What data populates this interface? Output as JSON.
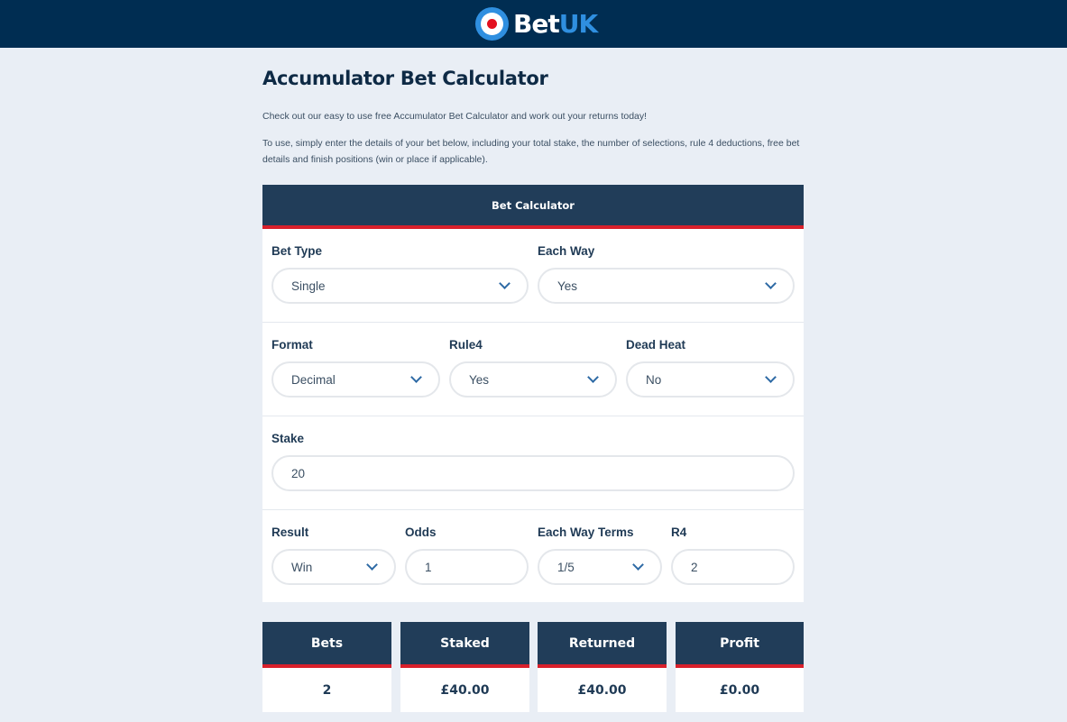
{
  "header": {
    "brand_part1": "Bet",
    "brand_part2": "UK",
    "logo_icon": "bullseye-logo-icon",
    "colors": {
      "background": "#002d52",
      "accent_blue": "#2f8fe0",
      "accent_red": "#e3101f"
    }
  },
  "page": {
    "title": "Accumulator Bet Calculator",
    "intro_1": "Check out our easy to use free Accumulator Bet Calculator and work out your returns today!",
    "intro_2": "To use, simply enter the details of your bet below, including your total stake, the number of selections, rule 4 deductions, free bet details and finish positions (win or place if applicable)."
  },
  "calculator": {
    "header": "Bet Calculator",
    "bet_type": {
      "label": "Bet Type",
      "value": "Single"
    },
    "each_way": {
      "label": "Each Way",
      "value": "Yes"
    },
    "format": {
      "label": "Format",
      "value": "Decimal"
    },
    "rule4": {
      "label": "Rule4",
      "value": "Yes"
    },
    "dead_heat": {
      "label": "Dead Heat",
      "value": "No"
    },
    "stake": {
      "label": "Stake",
      "value": "20"
    },
    "result": {
      "label": "Result",
      "value": "Win"
    },
    "odds": {
      "label": "Odds",
      "value": "1"
    },
    "each_way_terms": {
      "label": "Each Way Terms",
      "value": "1/5"
    },
    "r4": {
      "label": "R4",
      "value": "2"
    },
    "colors": {
      "panel_header": "#213d59",
      "accent_red": "#d9202b",
      "chevron": "#2e6aa5"
    }
  },
  "summary": [
    {
      "label": "Bets",
      "value": "2"
    },
    {
      "label": "Staked",
      "value": "£40.00"
    },
    {
      "label": "Returned",
      "value": "£40.00"
    },
    {
      "label": "Profit",
      "value": "£0.00"
    }
  ]
}
